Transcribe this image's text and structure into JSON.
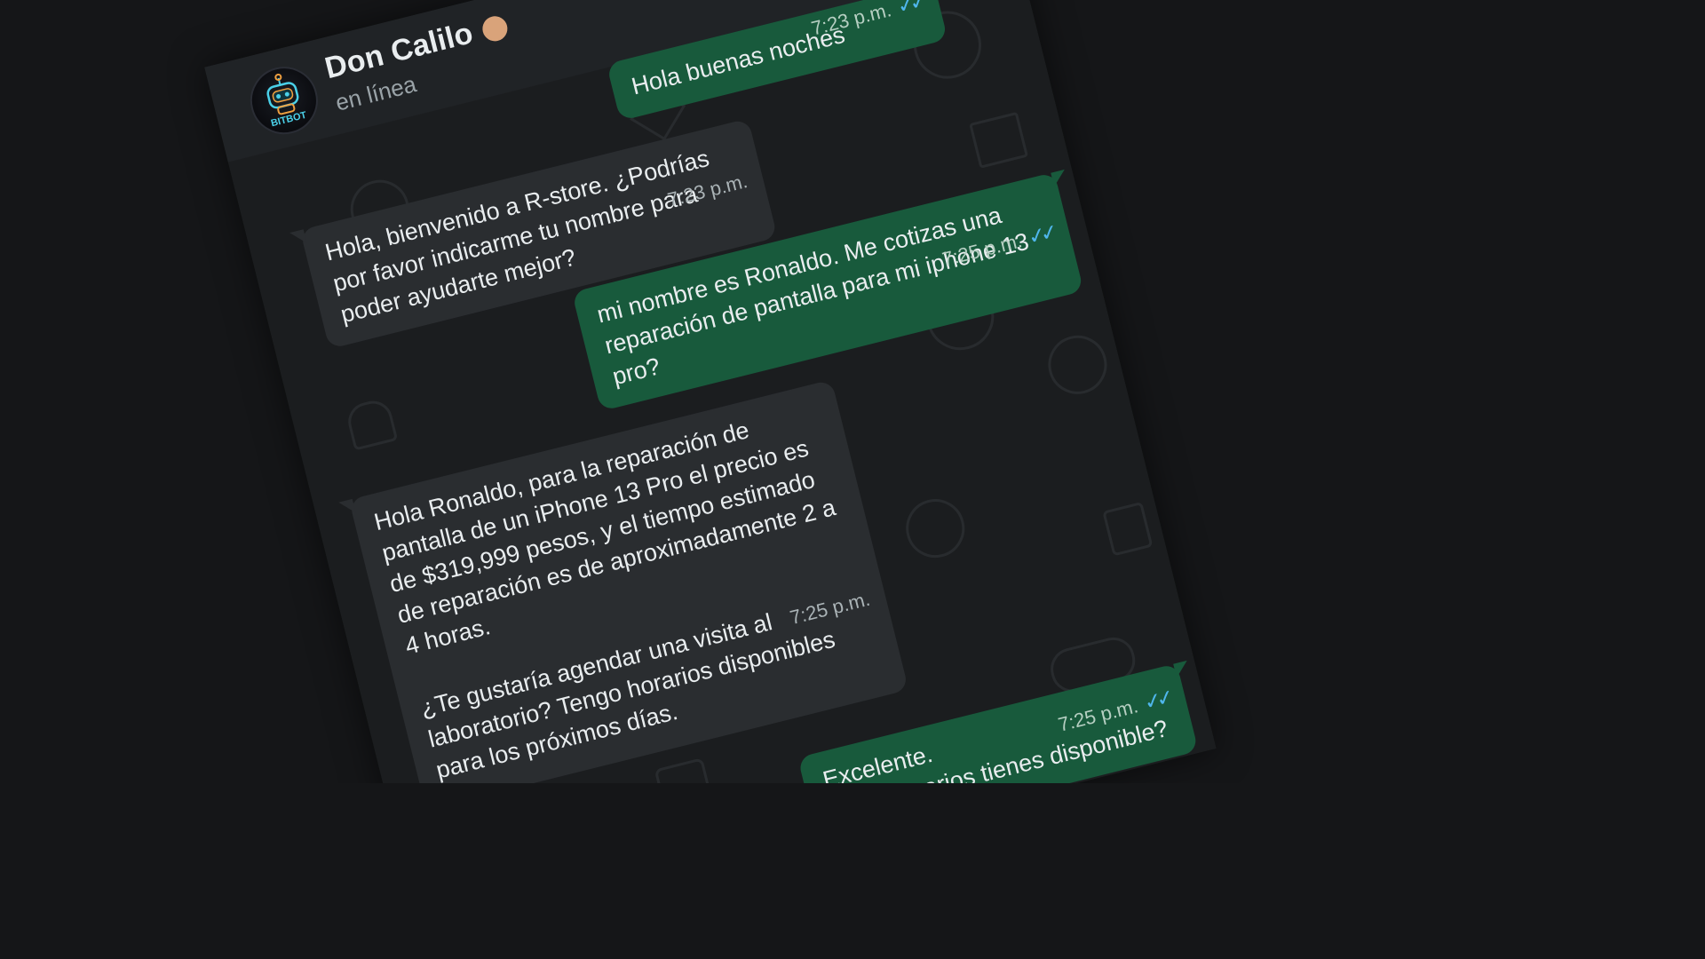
{
  "header": {
    "contact_name": "Don Calilo",
    "status": "en línea",
    "avatar_label": "BITBOT"
  },
  "messages": [
    {
      "direction": "outgoing",
      "text": "Hola buenas noches",
      "time": "7:23 p.m.",
      "read": true
    },
    {
      "direction": "incoming",
      "text": "Hola, bienvenido a R-store. ¿Podrías por favor indicarme tu nombre para poder ayudarte mejor?",
      "time": "7:23 p.m."
    },
    {
      "direction": "outgoing",
      "text": "mi nombre es Ronaldo. Me cotizas una reparación de pantalla para mi iphone 13 pro?",
      "time": "7:25 p.m.",
      "read": true
    },
    {
      "direction": "incoming",
      "text": "Hola Ronaldo, para la reparación de pantalla de un iPhone 13 Pro el precio es de $319,999 pesos, y el tiempo estimado de reparación es de aproximadamente 2 a 4 horas.\n\n¿Te gustaría agendar una visita al laboratorio? Tengo horarios disponibles para los próximos días.",
      "time": "7:25 p.m."
    },
    {
      "direction": "outgoing",
      "text": "Excelente.\n¿que horarios tienes disponible?",
      "time": "7:25 p.m.",
      "read": true
    }
  ],
  "colors": {
    "background": "#151618",
    "incoming_bubble": "#2a2d30",
    "outgoing_bubble": "#185a3c",
    "read_ticks": "#4fb6ec",
    "text": "#e9edef"
  },
  "icons": {
    "read_receipt": "double-check-icon",
    "avatar": "robot-icon"
  }
}
